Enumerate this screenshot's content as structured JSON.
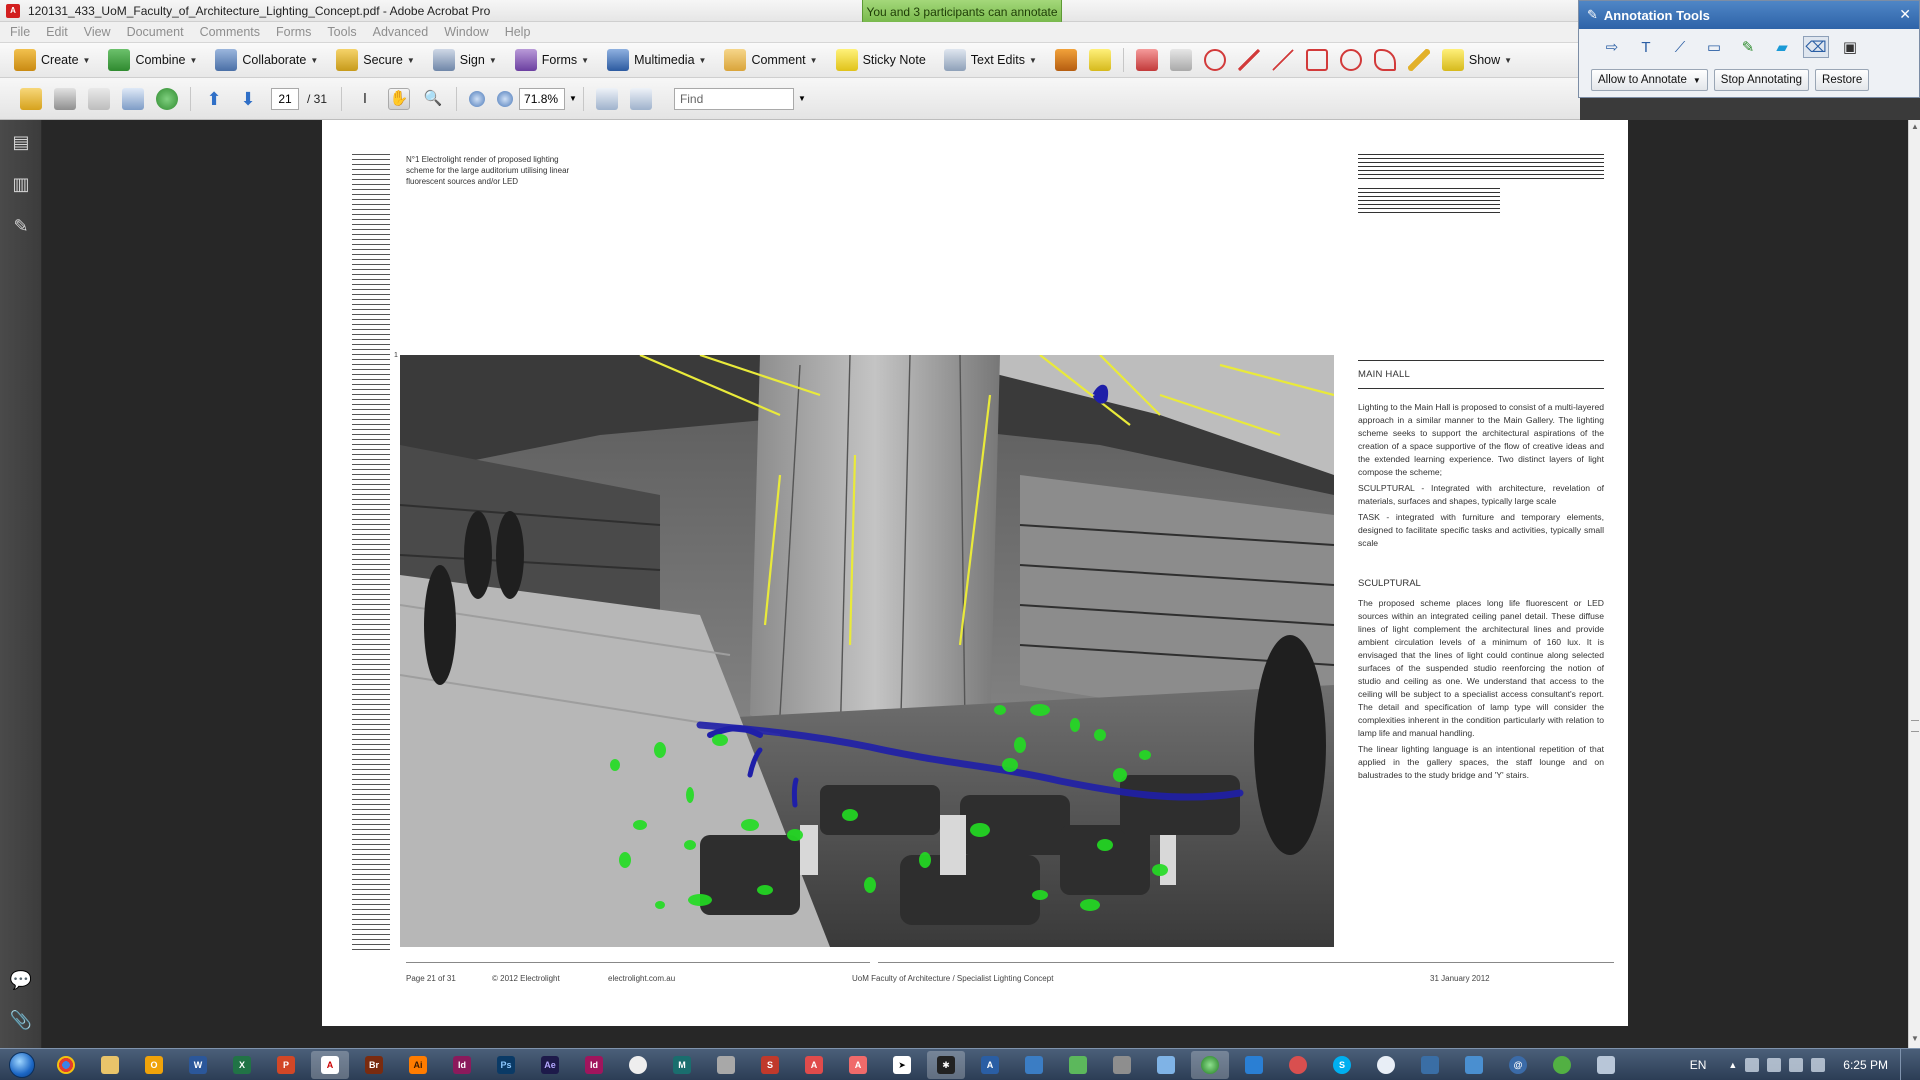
{
  "window": {
    "title": "120131_433_UoM_Faculty_of_Architecture_Lighting_Concept.pdf - Adobe Acrobat Pro",
    "participants_banner": "You and 3 participants can annotate"
  },
  "menu": [
    "File",
    "Edit",
    "View",
    "Document",
    "Comments",
    "Forms",
    "Tools",
    "Advanced",
    "Window",
    "Help"
  ],
  "toolbar": {
    "create": "Create",
    "combine": "Combine",
    "collaborate": "Collaborate",
    "secure": "Secure",
    "sign": "Sign",
    "forms": "Forms",
    "multimedia": "Multimedia",
    "comment": "Comment",
    "sticky_note": "Sticky Note",
    "text_edits": "Text Edits",
    "show": "Show"
  },
  "nav": {
    "current_page": "21",
    "total_pages": "/ 31",
    "zoom": "71.8%",
    "find_placeholder": "Find"
  },
  "annotation_panel": {
    "title": "Annotation Tools",
    "allow_label": "Allow to Annotate",
    "stop_label": "Stop Annotating",
    "restore_label": "Restore"
  },
  "document": {
    "caption": "N°1 Electrolight render of proposed lighting scheme for the large auditorium utilising linear fluorescent sources and/or LED",
    "heading": "MAIN HALL",
    "intro": "Lighting to the Main Hall is proposed to consist of a multi-layered approach in a similar manner to the Main Gallery. The lighting scheme seeks to support the architectural aspirations of the creation of a space supportive of the flow of creative ideas and the extended learning experience. Two distinct layers of light compose the scheme;",
    "sculptural_def": "SCULPTURAL - Integrated with architecture, revelation of materials, surfaces and shapes, typically large scale",
    "task_def": "TASK - integrated with furniture and temporary elements, designed to facilitate specific tasks and activities, typically small scale",
    "subheading": "SCULPTURAL",
    "sculptural_para": "The proposed scheme places long life fluorescent or LED sources within an integrated ceiling panel detail. These diffuse lines of light complement the architectural lines and provide ambient circulation levels of a minimum of 160 lux. It is envisaged that the lines of light could continue along selected surfaces of the suspended studio reenforcing the notion of studio and ceiling as one. We understand that access to the ceiling will be subject to a specialist access consultant's report. The detail and specification of lamp type will consider the complexities inherent in the condition particularly with relation to lamp life and manual handling.",
    "linear_para": "The linear lighting language is an intentional repetition of that applied in the gallery spaces, the staff lounge and on balustrades to the study bridge and 'Y' stairs.",
    "figure_number": "1"
  },
  "footer": {
    "page": "Page 21 of 31",
    "copyright": "© 2012 Electrolight",
    "website": "electrolight.com.au",
    "project": "UoM Faculty of Architecture / Specialist Lighting Concept",
    "date": "31 January 2012"
  },
  "taskbar": {
    "language": "EN",
    "clock": "6:25 PM"
  },
  "colors": {
    "accent_blue": "#2e63a8",
    "annotation_green": "#22dd22",
    "annotation_blue": "#2222aa",
    "participants_green": "#8ccb5f"
  }
}
